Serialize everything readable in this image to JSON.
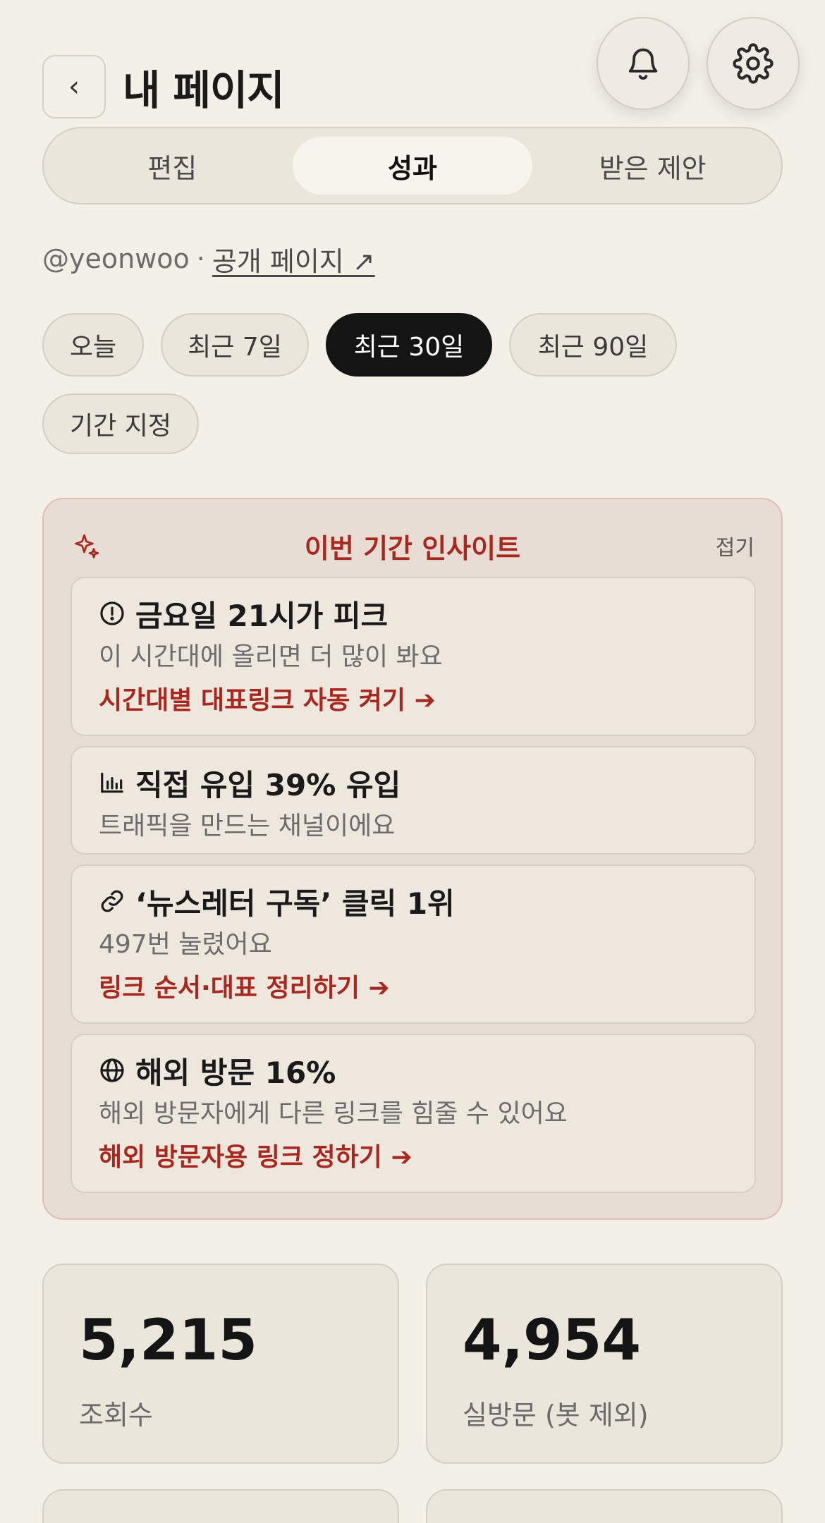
{
  "header": {
    "back_label": "‹",
    "title": "내 페이지",
    "bell_icon": "bell-icon",
    "settings_icon": "gear-icon"
  },
  "tabs": [
    {
      "label": "편집",
      "active": false
    },
    {
      "label": "성과",
      "active": true
    },
    {
      "label": "받은 제안",
      "active": false
    }
  ],
  "profile": {
    "handle": "@yeonwoo",
    "separator": "·",
    "public_link": "공개 페이지 ↗"
  },
  "ranges": [
    {
      "label": "오늘",
      "active": false
    },
    {
      "label": "최근 7일",
      "active": false
    },
    {
      "label": "최근 30일",
      "active": true
    },
    {
      "label": "최근 90일",
      "active": false
    },
    {
      "label": "기간 지정",
      "active": false
    }
  ],
  "insights": {
    "title": "이번 기간 인사이트",
    "collapse_label": "접기",
    "accent_color": "#a8281f",
    "items": [
      {
        "icon": "alert-circle-icon",
        "title": "금요일 21시가 피크",
        "desc": "이 시간대에 올리면 더 많이 봐요",
        "action": "시간대별 대표링크 자동 켜기 ➔"
      },
      {
        "icon": "bar-chart-icon",
        "title": "직접 유입 39% 유입",
        "desc": "트래픽을 만드는 채널이에요",
        "action": ""
      },
      {
        "icon": "link-icon",
        "title": "‘뉴스레터 구독’ 클릭 1위",
        "desc": "497번 눌렸어요",
        "action": "링크 순서·대표 정리하기 ➔"
      },
      {
        "icon": "globe-icon",
        "title": "해외 방문 16%",
        "desc": "해외 방문자에게 다른 링크를 힘줄 수 있어요",
        "action": "해외 방문자용 링크 정하기 ➔"
      }
    ]
  },
  "stats": [
    {
      "value": "5,215",
      "label": "조회수"
    },
    {
      "value": "4,954",
      "label": "실방문 (봇 제외)"
    }
  ]
}
